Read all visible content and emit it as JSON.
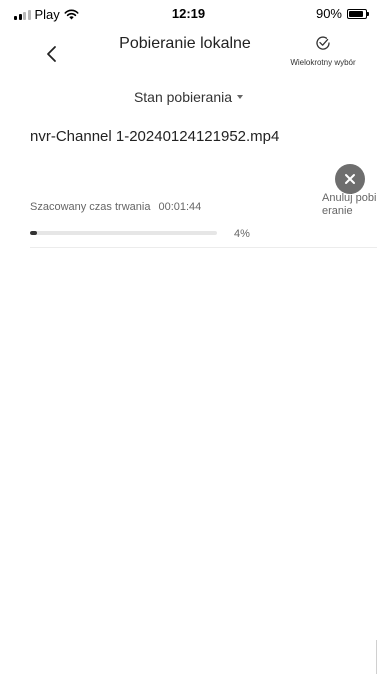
{
  "status_bar": {
    "carrier": "Play",
    "time": "12:19",
    "battery": "90%"
  },
  "nav": {
    "title": "Pobieranie lokalne",
    "multi_select_label": "Wielokrotny wybór"
  },
  "filter": {
    "label": "Stan pobierania"
  },
  "download": {
    "file_name": "nvr-Channel 1-20240124121952.mp4",
    "duration_label": "Szacowany czas trwania",
    "duration_value": "00:01:44",
    "progress_percent": 4,
    "progress_text": "4%",
    "cancel_label": "Anuluj pobieranie"
  },
  "colors": {
    "progress_fill": "#333333",
    "progress_track": "#e6e6e6",
    "cancel_button": "#6e6e6e"
  },
  "icons": {
    "back": "chevron-left-icon",
    "multi_select": "check-circle-icon",
    "cancel": "close-icon",
    "caret": "caret-down-icon"
  }
}
